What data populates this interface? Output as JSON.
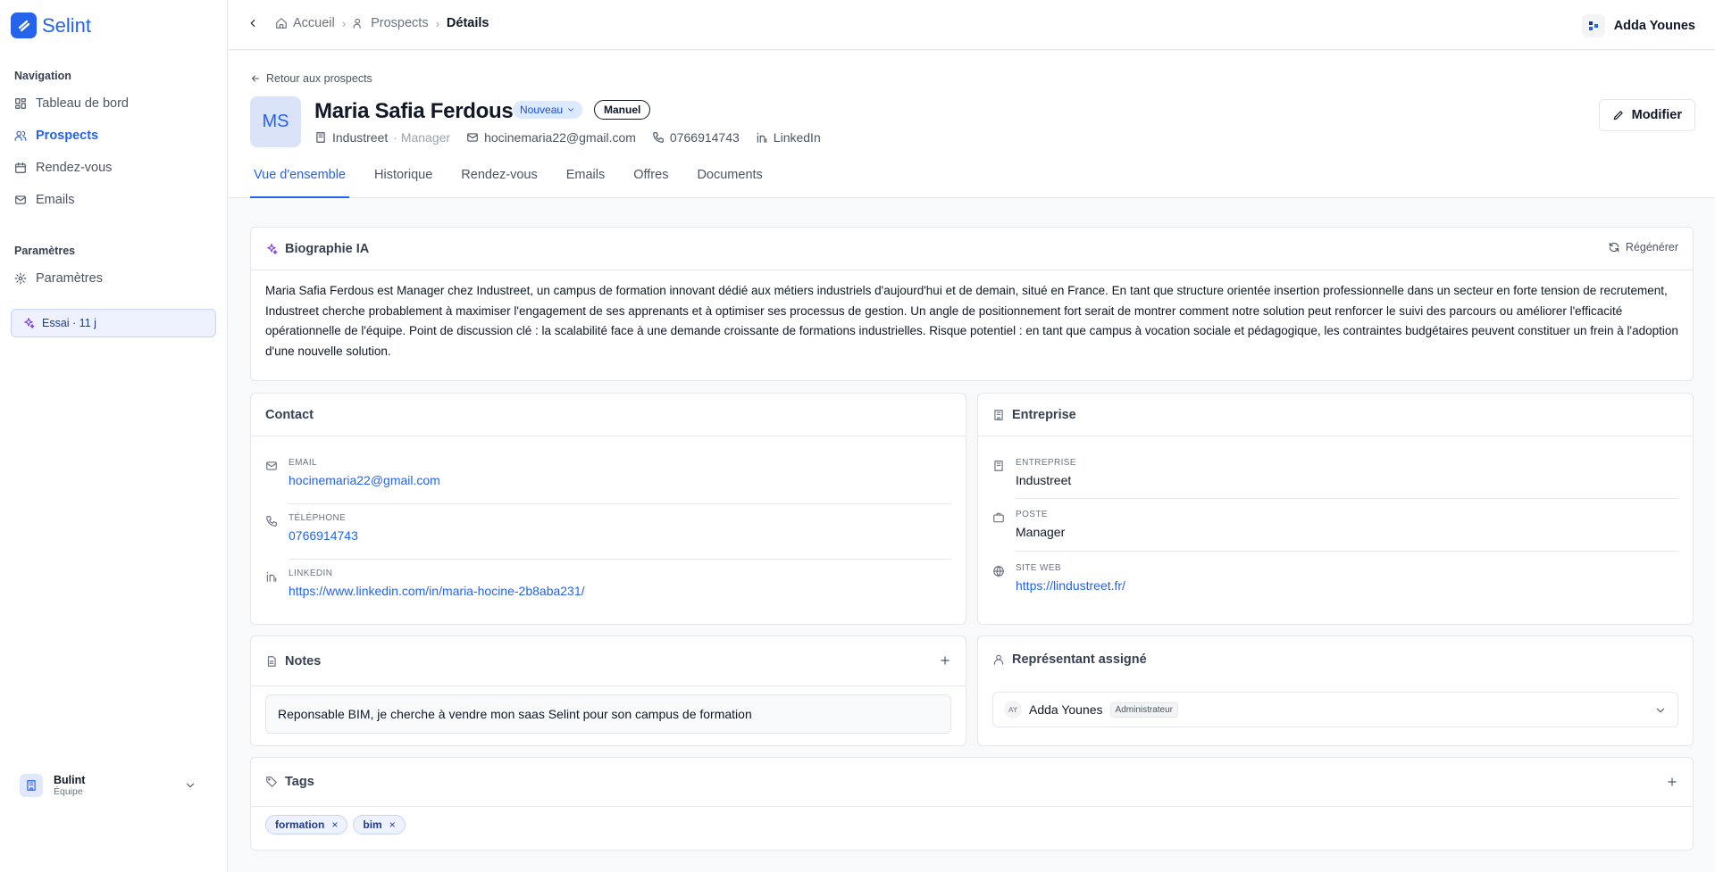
{
  "app": {
    "name": "Selint"
  },
  "sidebar": {
    "nav_title": "Navigation",
    "items": [
      {
        "label": "Tableau de bord"
      },
      {
        "label": "Prospects"
      },
      {
        "label": "Rendez-vous"
      },
      {
        "label": "Emails"
      }
    ],
    "settings_title": "Paramètres",
    "settings_item": "Paramètres",
    "trial": "Essai · 11 j",
    "team": {
      "name": "Bulint",
      "role": "Équipe"
    }
  },
  "topbar": {
    "breadcrumb": [
      "Accueil",
      "Prospects",
      "Détails"
    ],
    "user": "Adda Younes"
  },
  "prospect": {
    "back_label": "Retour aux prospects",
    "initials": "MS",
    "name": "Maria Safia Ferdous",
    "status": "Nouveau",
    "source": "Manuel",
    "company": "Industreet",
    "role": "· Manager",
    "email": "hocinemaria22@gmail.com",
    "phone": "0766914743",
    "linkedin_label": "LinkedIn",
    "edit_label": "Modifier"
  },
  "tabs": [
    "Vue d'ensemble",
    "Historique",
    "Rendez-vous",
    "Emails",
    "Offres",
    "Documents"
  ],
  "bio": {
    "title": "Biographie IA",
    "regen": "Régénérer",
    "text": "Maria Safia Ferdous est Manager chez Industreet, un campus de formation innovant dédié aux métiers industriels d'aujourd'hui et de demain, situé en France. En tant que structure orientée insertion professionnelle dans un secteur en forte tension de recrutement, Industreet cherche probablement à maximiser l'engagement de ses apprenants et à optimiser ses processus de gestion. Un angle de positionnement fort serait de montrer comment notre solution peut renforcer le suivi des parcours ou améliorer l'efficacité opérationnelle de l'équipe. Point de discussion clé : la scalabilité face à une demande croissante de formations industrielles. Risque potentiel : en tant que campus à vocation sociale et pédagogique, les contraintes budgétaires peuvent constituer un frein à l'adoption d'une nouvelle solution."
  },
  "contact": {
    "title": "Contact",
    "email_label": "EMAIL",
    "email": "hocinemaria22@gmail.com",
    "phone_label": "TÉLÉPHONE",
    "phone": "0766914743",
    "linkedin_label": "LINKEDIN",
    "linkedin": "https://www.linkedin.com/in/maria-hocine-2b8aba231/"
  },
  "company": {
    "title": "Entreprise",
    "company_label": "ENTREPRISE",
    "company": "Industreet",
    "role_label": "POSTE",
    "role": "Manager",
    "site_label": "SITE WEB",
    "site": "https://lindustreet.fr/"
  },
  "notes": {
    "title": "Notes",
    "text": "Reponsable BIM, je cherche à vendre mon saas Selint pour son campus de formation"
  },
  "rep": {
    "title": "Représentant assigné",
    "initials": "AY",
    "name": "Adda Younes",
    "role": "Administrateur"
  },
  "tags": {
    "title": "Tags",
    "items": [
      "formation",
      "bim"
    ]
  },
  "colors": {
    "accent": "#2563eb",
    "ai": "#7c3aed"
  }
}
